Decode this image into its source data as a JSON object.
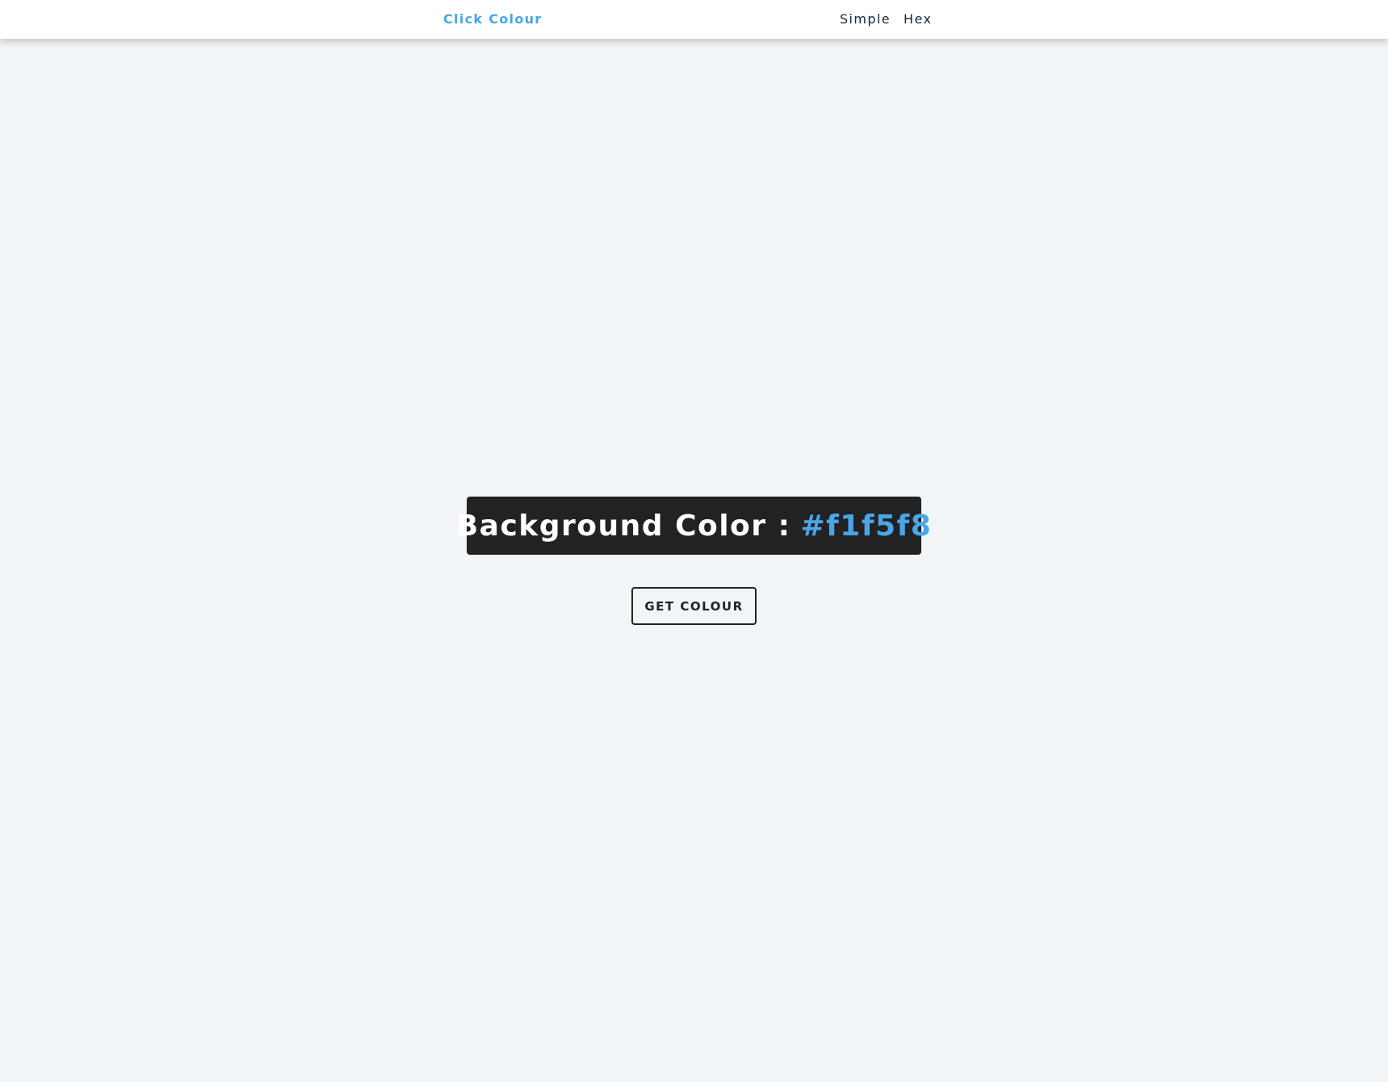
{
  "navbar": {
    "brand": "Click Colour",
    "links": [
      {
        "label": "Simple"
      },
      {
        "label": "Hex"
      }
    ]
  },
  "main": {
    "banner_label": "Background Color :",
    "color_value": "#f1f5f8",
    "button_label": "GET COLOUR"
  },
  "colors": {
    "page_background": "#f1f5f8",
    "accent": "#49a6e9",
    "nav_text": "#102a42",
    "banner_background": "#222222",
    "navbar_background": "#ffffff"
  }
}
